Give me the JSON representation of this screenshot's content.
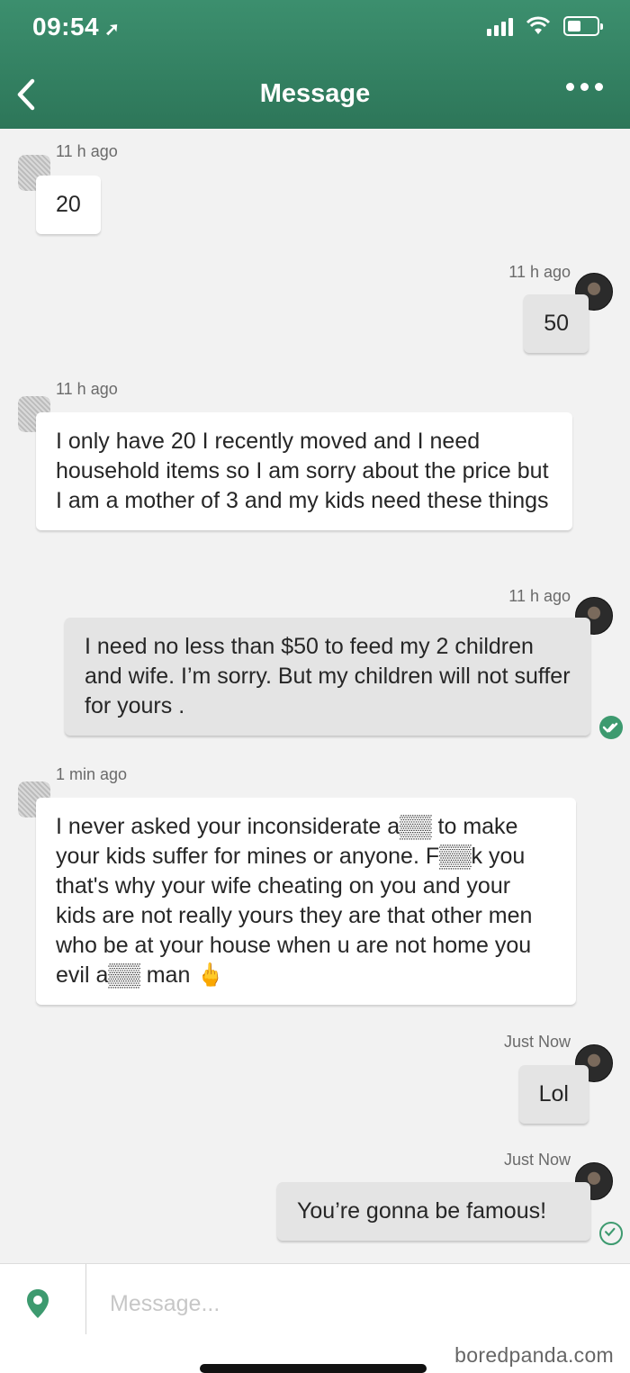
{
  "status_bar": {
    "time": "09:54",
    "location_arrow": "location-arrow-icon"
  },
  "header": {
    "title": "Message",
    "back_icon": "chevron-left-icon",
    "more_icon": "more-dots-icon"
  },
  "messages": [
    {
      "direction": "incoming",
      "time": "11 h ago",
      "text": "20"
    },
    {
      "direction": "outgoing",
      "time": "11 h ago",
      "text": "50"
    },
    {
      "direction": "incoming",
      "time": "11 h ago",
      "text": "I only have 20 I recently moved and I need household items so I am sorry about the price but I am a mother of 3 and my kids need these things"
    },
    {
      "direction": "outgoing",
      "time": "11 h ago",
      "text": "I need no less than $50 to feed my 2 children and wife. I’m sorry. But my children will not suffer for yours .",
      "status": "read"
    },
    {
      "direction": "incoming",
      "time": "1 min ago",
      "text": "I never asked your inconsiderate a▒▒ to make your kids suffer for mines or anyone. F▒▒k you that's why your wife cheating on you and your kids are not really yours they are that other men who be at your house when u are not home you evil a▒▒ man 🖕"
    },
    {
      "direction": "outgoing",
      "time": "Just Now",
      "text": "Lol"
    },
    {
      "direction": "outgoing",
      "time": "Just Now",
      "text": "You’re gonna be famous!",
      "status": "delivered"
    }
  ],
  "composer": {
    "placeholder": "Message...",
    "location_icon": "map-pin-icon"
  },
  "watermark": "boredpanda.com",
  "colors": {
    "header": "#2f7a5c",
    "check": "#3d9a6f"
  }
}
